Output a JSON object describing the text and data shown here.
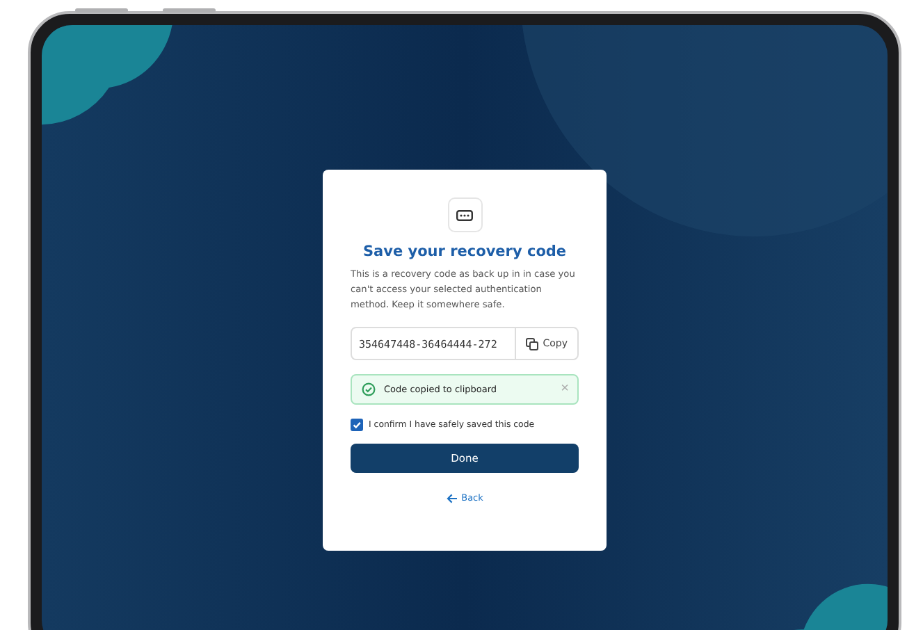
{
  "dialog": {
    "title": "Save your recovery code",
    "description": "This is a recovery code as back up in in case you can't access your selected authentication method. Keep it somewhere safe.",
    "code_field": {
      "value": "354647448-36464444-272"
    },
    "copy_button": {
      "label": "Copy"
    },
    "alert": {
      "message": "Code copied to clipboard",
      "dismiss": "×"
    },
    "confirm": {
      "label": "I confirm I have safely saved this code",
      "checked": true
    },
    "done_button": {
      "label": "Done"
    },
    "back_link": {
      "label": "Back"
    }
  }
}
